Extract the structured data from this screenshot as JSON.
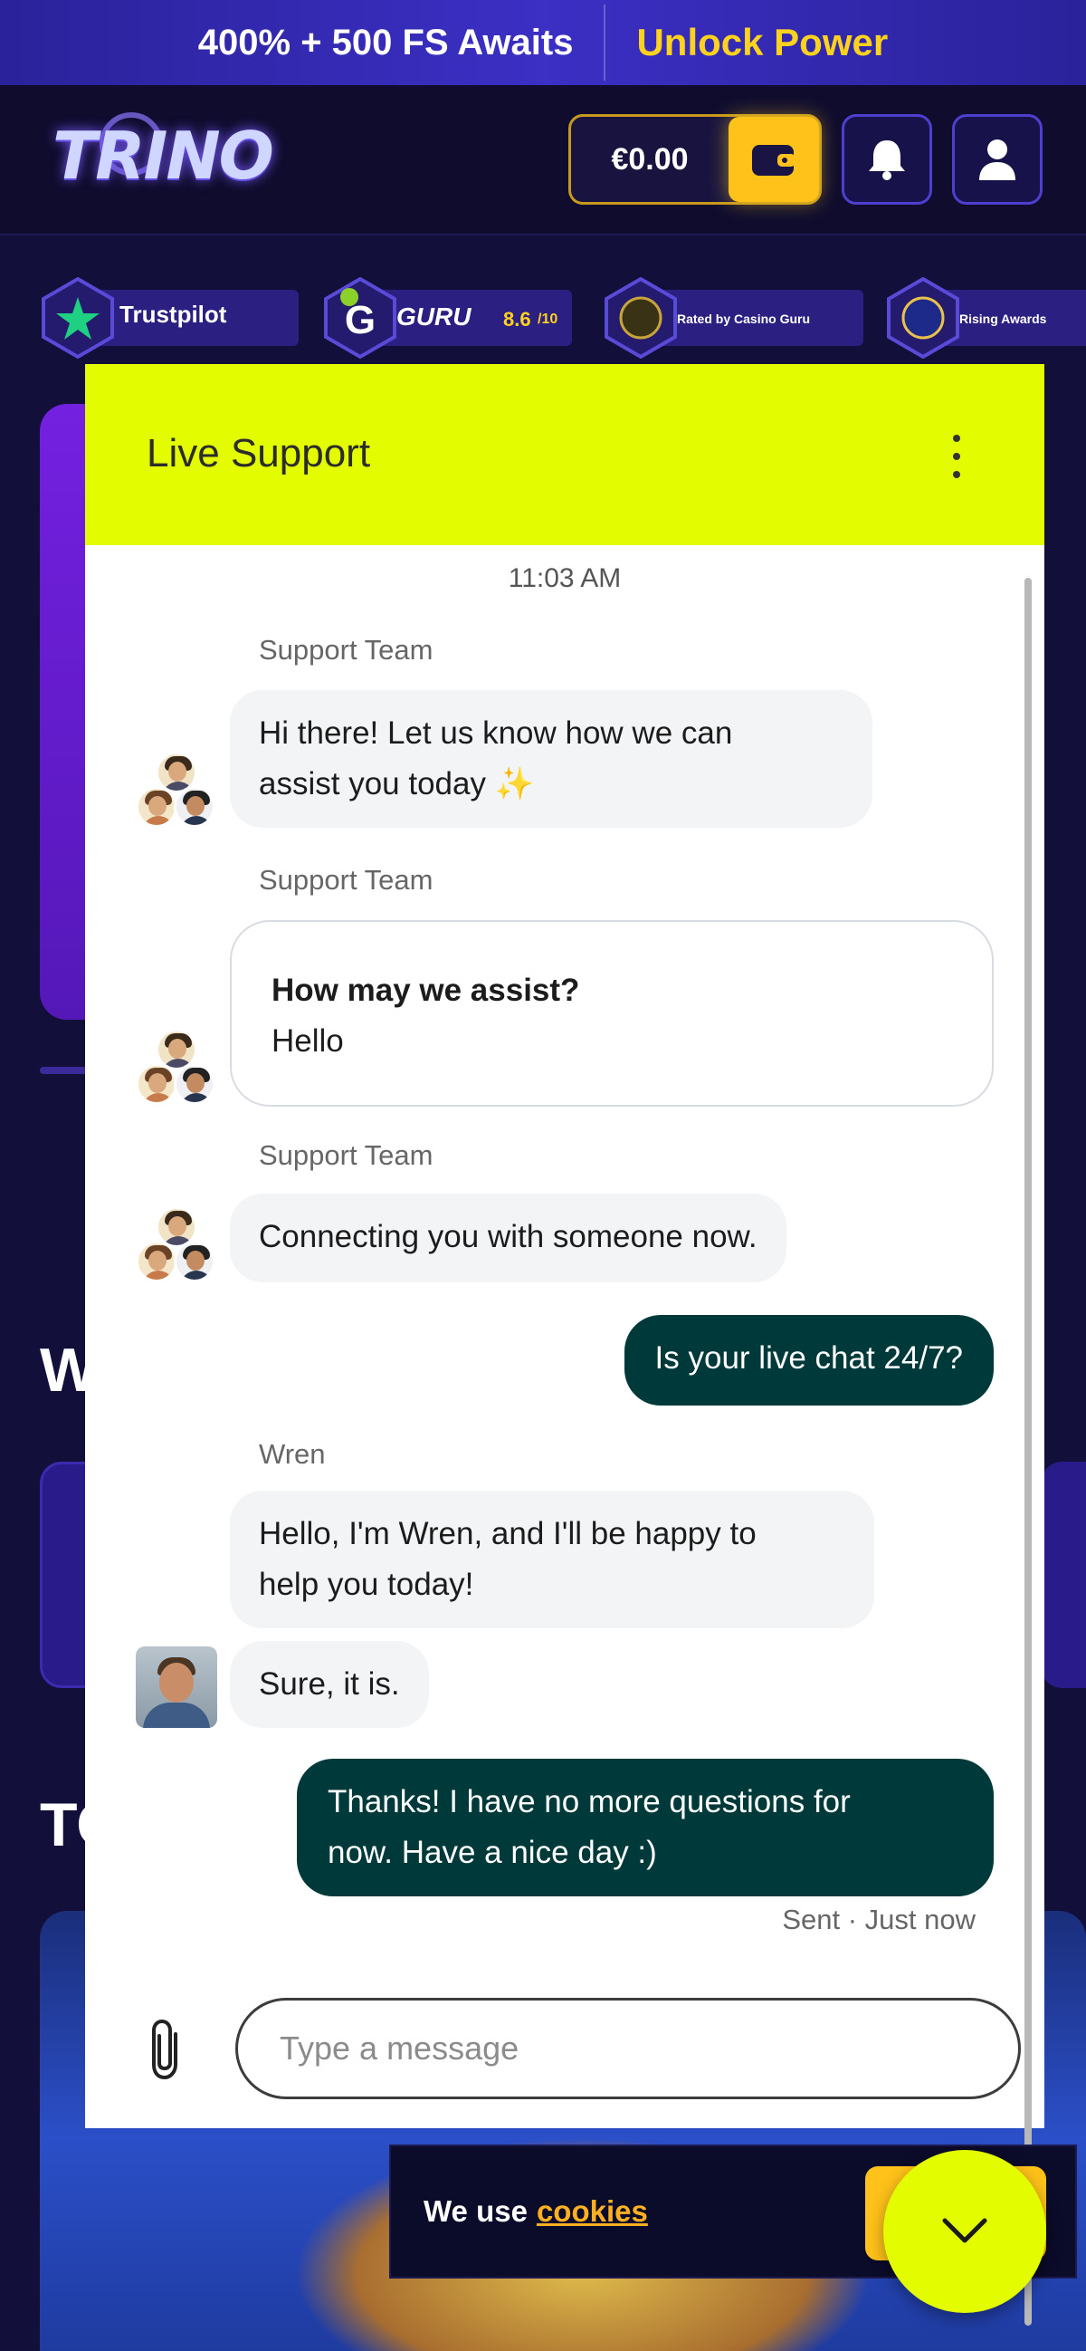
{
  "promo": {
    "left_text": "400% + 500 FS Awaits",
    "right_text": "Unlock Power",
    "colors": {
      "accent": "#ffd21e"
    }
  },
  "header": {
    "logo_text": "TRINO",
    "balance": "€0.00",
    "icons": [
      "wallet-icon",
      "bell-icon",
      "user-icon"
    ]
  },
  "badges": [
    {
      "name": "trustpilot",
      "label": "Trustpilot"
    },
    {
      "name": "casino-guru",
      "label": "GURU",
      "rating": "8.6",
      "rating_scale": "/10"
    },
    {
      "name": "rated-by-casino-guru",
      "label": "Rated by Casino Guru"
    },
    {
      "name": "rating-badge",
      "label": "Rising Awards"
    }
  ],
  "background": {
    "heading_1": "W",
    "heading_2": "TO"
  },
  "chat": {
    "title": "Live Support",
    "timestamp": "11:03 AM",
    "colors": {
      "header": "#e3fd00",
      "outgoing": "#00393a"
    },
    "messages": [
      {
        "sender": "Support Team",
        "text_line1": "Hi there! Let us know how we can",
        "text_line2": "assist you today ✨"
      },
      {
        "sender": "Support Team",
        "card_title": "How may we assist?",
        "card_body": "Hello"
      },
      {
        "sender": "Support Team",
        "text": "Connecting you with someone now."
      },
      {
        "sender": "You",
        "text": "Is your live chat 24/7?"
      },
      {
        "sender": "Wren",
        "text_line1": "Hello, I'm Wren, and I'll be happy to",
        "text_line2": "help you today!"
      },
      {
        "sender": "Wren",
        "text": "Sure, it is."
      },
      {
        "sender": "You",
        "text_line1": "Thanks! I have no more questions for",
        "text_line2": "now. Have a nice day :)"
      }
    ],
    "sent_status": "Sent · Just now",
    "input_placeholder": "Type a message"
  },
  "cookie": {
    "text": "We use",
    "link": "cookies"
  }
}
